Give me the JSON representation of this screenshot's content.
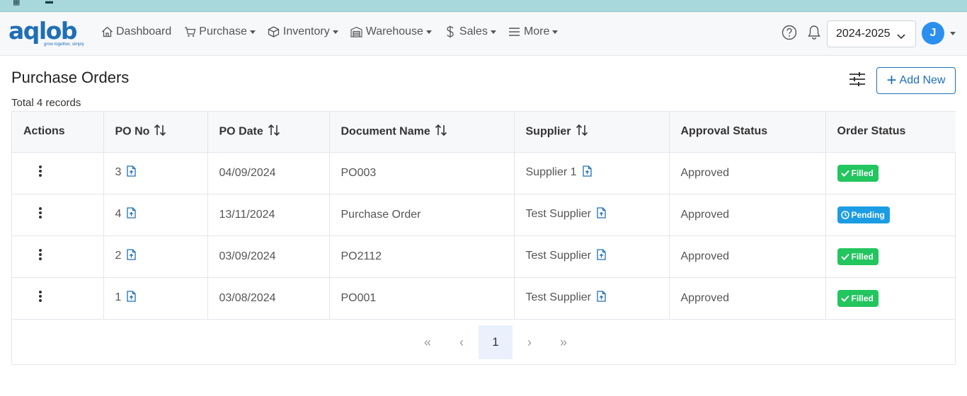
{
  "app": {
    "logo_text": "aqlob",
    "logo_tagline": "grow together, simply"
  },
  "nav": {
    "items": [
      {
        "label": "Dashboard",
        "icon": "home-icon",
        "has_caret": false
      },
      {
        "label": "Purchase",
        "icon": "cart-icon",
        "has_caret": true
      },
      {
        "label": "Inventory",
        "icon": "box-icon",
        "has_caret": true
      },
      {
        "label": "Warehouse",
        "icon": "warehouse-icon",
        "has_caret": true
      },
      {
        "label": "Sales",
        "icon": "dollar-icon",
        "has_caret": true
      },
      {
        "label": "More",
        "icon": "menu-icon",
        "has_caret": true
      }
    ],
    "year_selected": "2024-2025",
    "avatar_initial": "J"
  },
  "page": {
    "title": "Purchase Orders",
    "record_count": "Total 4 records",
    "add_button": "Add New"
  },
  "table": {
    "columns": [
      "Actions",
      "PO No",
      "PO Date",
      "Document Name",
      "Supplier",
      "Approval Status",
      "Order Status"
    ],
    "rows": [
      {
        "po_no": "3",
        "po_date": "04/09/2024",
        "document_name": "PO003",
        "supplier": "Supplier 1",
        "approval": "Approved",
        "order_status": "Filled"
      },
      {
        "po_no": "4",
        "po_date": "13/11/2024",
        "document_name": "Purchase Order",
        "supplier": "Test Supplier",
        "approval": "Approved",
        "order_status": "Pending"
      },
      {
        "po_no": "2",
        "po_date": "03/09/2024",
        "document_name": "PO2112",
        "supplier": "Test Supplier",
        "approval": "Approved",
        "order_status": "Filled"
      },
      {
        "po_no": "1",
        "po_date": "03/08/2024",
        "document_name": "PO001",
        "supplier": "Test Supplier",
        "approval": "Approved",
        "order_status": "Filled"
      }
    ]
  },
  "pagination": {
    "first": "«",
    "prev": "‹",
    "current": "1",
    "next": "›",
    "last": "»"
  },
  "colors": {
    "brand": "#1f6fb6",
    "filled": "#22c55e",
    "pending": "#1c9ce3",
    "browser_strip": "#a8d8dc"
  }
}
